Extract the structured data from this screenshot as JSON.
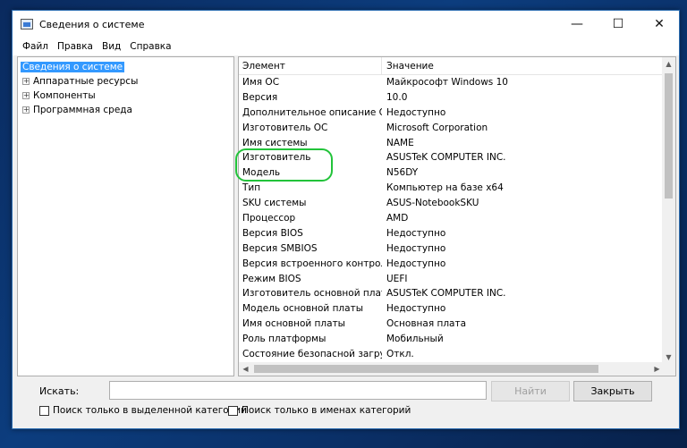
{
  "window": {
    "title": "Сведения о системе",
    "controls": {
      "minimize": "—",
      "maximize": "☐",
      "close": "✕"
    }
  },
  "menu": [
    "Файл",
    "Правка",
    "Вид",
    "Справка"
  ],
  "tree": {
    "root": "Сведения о системе",
    "children": [
      "Аппаратные ресурсы",
      "Компоненты",
      "Программная среда"
    ]
  },
  "list": {
    "headers": {
      "element": "Элемент",
      "value": "Значение"
    },
    "rows": [
      {
        "name": "Имя ОС",
        "value": "Майкрософт Windows 10"
      },
      {
        "name": "Версия",
        "value": "10.0"
      },
      {
        "name": "Дополнительное описание ОС",
        "value": "Недоступно"
      },
      {
        "name": "Изготовитель ОС",
        "value": "Microsoft Corporation"
      },
      {
        "name": "Имя системы",
        "value": "NAME"
      },
      {
        "name": "Изготовитель",
        "value": "ASUSTeK COMPUTER INC."
      },
      {
        "name": "Модель",
        "value": "N56DY"
      },
      {
        "name": "Тип",
        "value": "Компьютер на базе x64"
      },
      {
        "name": "SKU системы",
        "value": "ASUS-NotebookSKU"
      },
      {
        "name": "Процессор",
        "value": "AMD"
      },
      {
        "name": "Версия BIOS",
        "value": "Недоступно"
      },
      {
        "name": "Версия SMBIOS",
        "value": "Недоступно"
      },
      {
        "name": "Версия встроенного контролл...",
        "value": "Недоступно"
      },
      {
        "name": "Режим BIOS",
        "value": "UEFI"
      },
      {
        "name": "Изготовитель основной платы",
        "value": "ASUSTeK COMPUTER INC."
      },
      {
        "name": "Модель основной платы",
        "value": "Недоступно"
      },
      {
        "name": "Имя основной платы",
        "value": "Основная плата"
      },
      {
        "name": "Роль платформы",
        "value": "Мобильный"
      },
      {
        "name": "Состояние безопасной загруз...",
        "value": "Откл."
      }
    ]
  },
  "search": {
    "label": "Искать:",
    "value": "",
    "find_button": "Найти",
    "close_button": "Закрыть",
    "check_selected": "Поиск только в выделенной категории",
    "check_names": "Поиск только в именах категорий"
  },
  "colors": {
    "selection": "#3399ff",
    "highlight_ring": "#22c33a"
  }
}
